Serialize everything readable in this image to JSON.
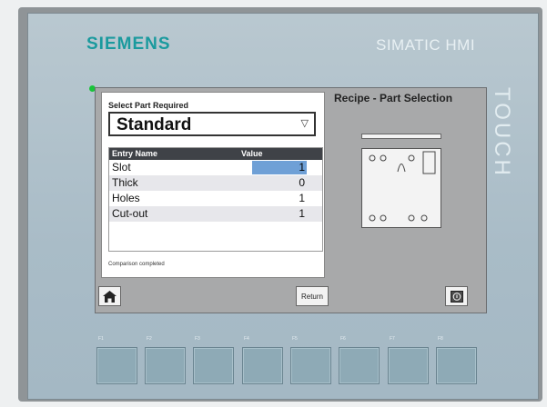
{
  "device": {
    "brand": "SIEMENS",
    "model": "SIMATIC HMI",
    "touch_label": "TOUCH"
  },
  "screen": {
    "select_label": "Select Part Required",
    "selected_part": "Standard",
    "table": {
      "headers": [
        "Entry Name",
        "Value"
      ],
      "rows": [
        {
          "name": "Slot",
          "value": "1"
        },
        {
          "name": "Thick",
          "value": "0"
        },
        {
          "name": "Holes",
          "value": "1"
        },
        {
          "name": "Cut-out",
          "value": "1"
        }
      ]
    },
    "status": "Comparison completed",
    "recipe_title": "Recipe - Part Selection",
    "buttons": {
      "return_label": "Return"
    }
  },
  "function_keys": [
    "F1",
    "F2",
    "F3",
    "F4",
    "F5",
    "F6",
    "F7",
    "F8"
  ],
  "colors": {
    "brand_teal": "#1a9a9e",
    "led_green": "#19c43a",
    "selected_cell": "#6fa0d6",
    "table_header": "#3f4247"
  },
  "icons": [
    "home-icon",
    "info-icon",
    "dropdown-arrow-icon"
  ]
}
